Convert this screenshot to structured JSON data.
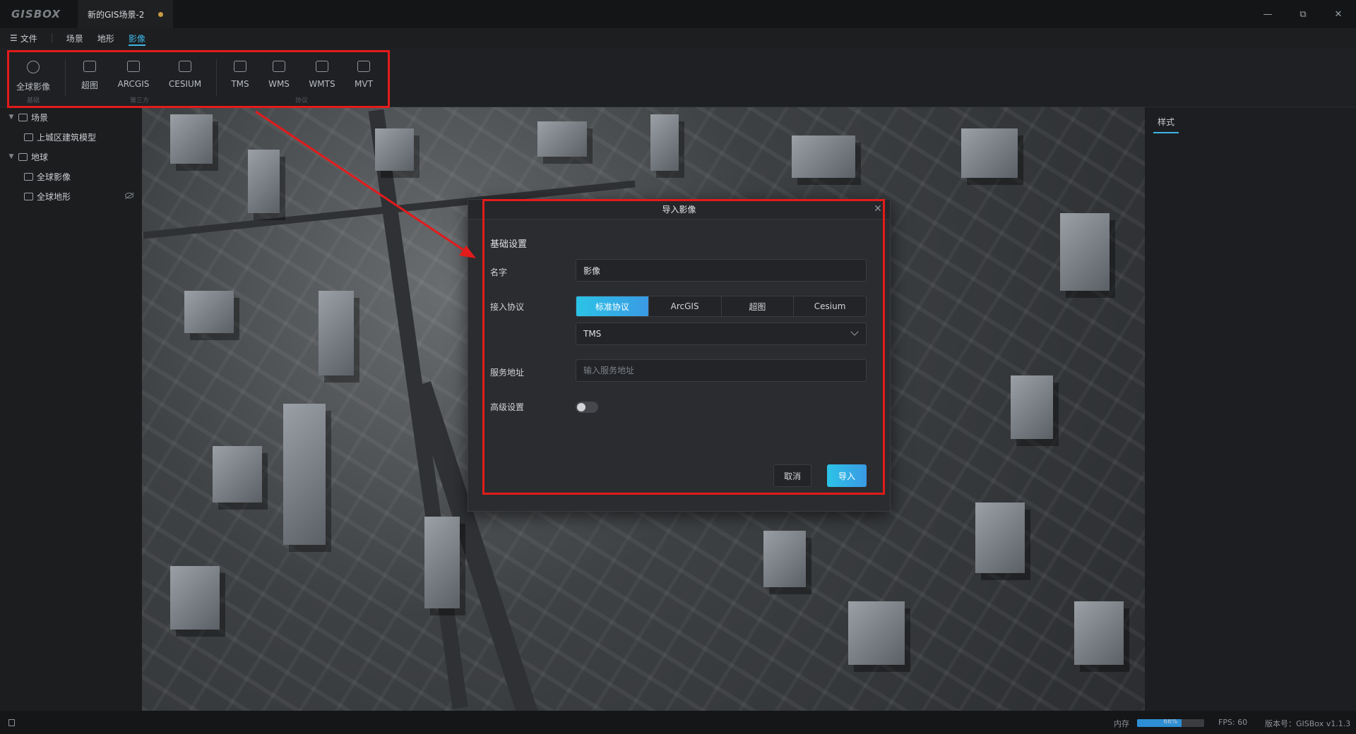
{
  "app": {
    "logo": "GISBOX",
    "doc_tab": "新的GIS场景-2"
  },
  "menubar": {
    "file": "文件",
    "items": [
      "场景",
      "地形",
      "影像"
    ],
    "active": "影像"
  },
  "toolbar": {
    "tools": [
      {
        "label": "全球影像",
        "icon": "globe-image-icon"
      },
      {
        "label": "超图",
        "icon": "supermap-icon"
      },
      {
        "label": "ARCGIS",
        "icon": "arcgis-icon"
      },
      {
        "label": "CESIUM",
        "icon": "cesium-icon"
      },
      {
        "label": "TMS",
        "icon": "tms-icon"
      },
      {
        "label": "WMS",
        "icon": "wms-icon"
      },
      {
        "label": "WMTS",
        "icon": "wmts-icon"
      },
      {
        "label": "MVT",
        "icon": "mvt-icon"
      }
    ],
    "groups": [
      "基础",
      "第三方",
      "协议"
    ]
  },
  "sidebar": {
    "tree": [
      {
        "label": "场景",
        "level": 0,
        "icon": "scene-icon"
      },
      {
        "label": "上城区建筑模型",
        "level": 1,
        "icon": "model-icon"
      },
      {
        "label": "地球",
        "level": 0,
        "icon": "earth-icon"
      },
      {
        "label": "全球影像",
        "level": 1,
        "icon": "imagery-icon"
      },
      {
        "label": "全球地形",
        "level": 1,
        "icon": "terrain-icon",
        "hidden": true
      }
    ]
  },
  "right_panel": {
    "tab": "样式"
  },
  "dialog": {
    "title": "导入影像",
    "section": "基础设置",
    "name_label": "名字",
    "name_value": "影像",
    "protocol_label": "接入协议",
    "protocols": [
      "标准协议",
      "ArcGIS",
      "超图",
      "Cesium"
    ],
    "protocol_active": "标准协议",
    "protocol_type": "TMS",
    "url_label": "服务地址",
    "url_placeholder": "输入服务地址",
    "advanced_label": "高级设置",
    "advanced_enabled": false,
    "cancel": "取消",
    "ok": "导入"
  },
  "statusbar": {
    "mem_label": "内存",
    "mem_percent": "66%",
    "mem_fraction": 0.66,
    "fps": "FPS: 60",
    "version": "版本号：GISBox v1.1.3"
  },
  "colors": {
    "accent": "#3db6e6",
    "annotation": "#e31b1b"
  }
}
